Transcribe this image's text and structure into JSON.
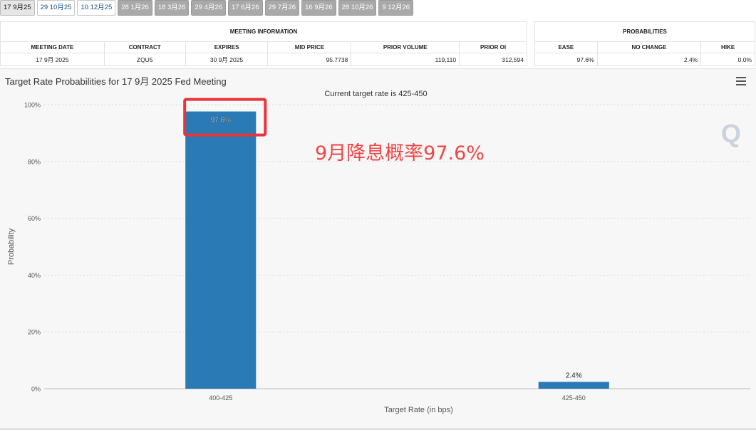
{
  "tabs": [
    {
      "label": "17 9月25",
      "state": "active"
    },
    {
      "label": "29 10月25",
      "state": "open"
    },
    {
      "label": "10 12月25",
      "state": "open"
    },
    {
      "label": "28 1月26",
      "state": "disabled"
    },
    {
      "label": "18 3月26",
      "state": "disabled"
    },
    {
      "label": "29 4月26",
      "state": "disabled"
    },
    {
      "label": "17 6月26",
      "state": "disabled"
    },
    {
      "label": "29 7月26",
      "state": "disabled"
    },
    {
      "label": "16 9月26",
      "state": "disabled"
    },
    {
      "label": "28 10月26",
      "state": "disabled"
    },
    {
      "label": "9 12月26",
      "state": "disabled"
    }
  ],
  "meeting_info": {
    "heading": "MEETING INFORMATION",
    "headers": [
      "MEETING DATE",
      "CONTRACT",
      "EXPIRES",
      "MID PRICE",
      "PRIOR VOLUME",
      "PRIOR OI"
    ],
    "row": [
      "17 9月 2025",
      "ZQU5",
      "30 9月 2025",
      "95.7738",
      "119,110",
      "312,594"
    ]
  },
  "probabilities": {
    "heading": "PROBABILITIES",
    "headers": [
      "EASE",
      "NO CHANGE",
      "HIKE"
    ],
    "row": [
      "97.6%",
      "2.4%",
      "0.0%"
    ]
  },
  "chart_title": "Target Rate Probabilities for 17 9月 2025 Fed Meeting",
  "annotation": {
    "text": "9月降息概率97.6%",
    "color": "#f04545"
  },
  "colors": {
    "bar": "#2a7ab5",
    "highlight": "#e8343a"
  },
  "chart_data": {
    "type": "bar",
    "title": "Target Rate Probabilities for 17 9月 2025 Fed Meeting",
    "subtitle": "Current target rate is 425-450",
    "categories": [
      "400-425",
      "425-450"
    ],
    "values": [
      97.6,
      2.4
    ],
    "data_labels": [
      "97.6%",
      "2.4%"
    ],
    "xlabel": "Target Rate (in bps)",
    "ylabel": "Probability",
    "ylim": [
      0,
      100
    ],
    "yticks": [
      "0%",
      "20%",
      "40%",
      "60%",
      "80%",
      "100%"
    ],
    "grid": true,
    "highlighted_category": "400-425"
  }
}
